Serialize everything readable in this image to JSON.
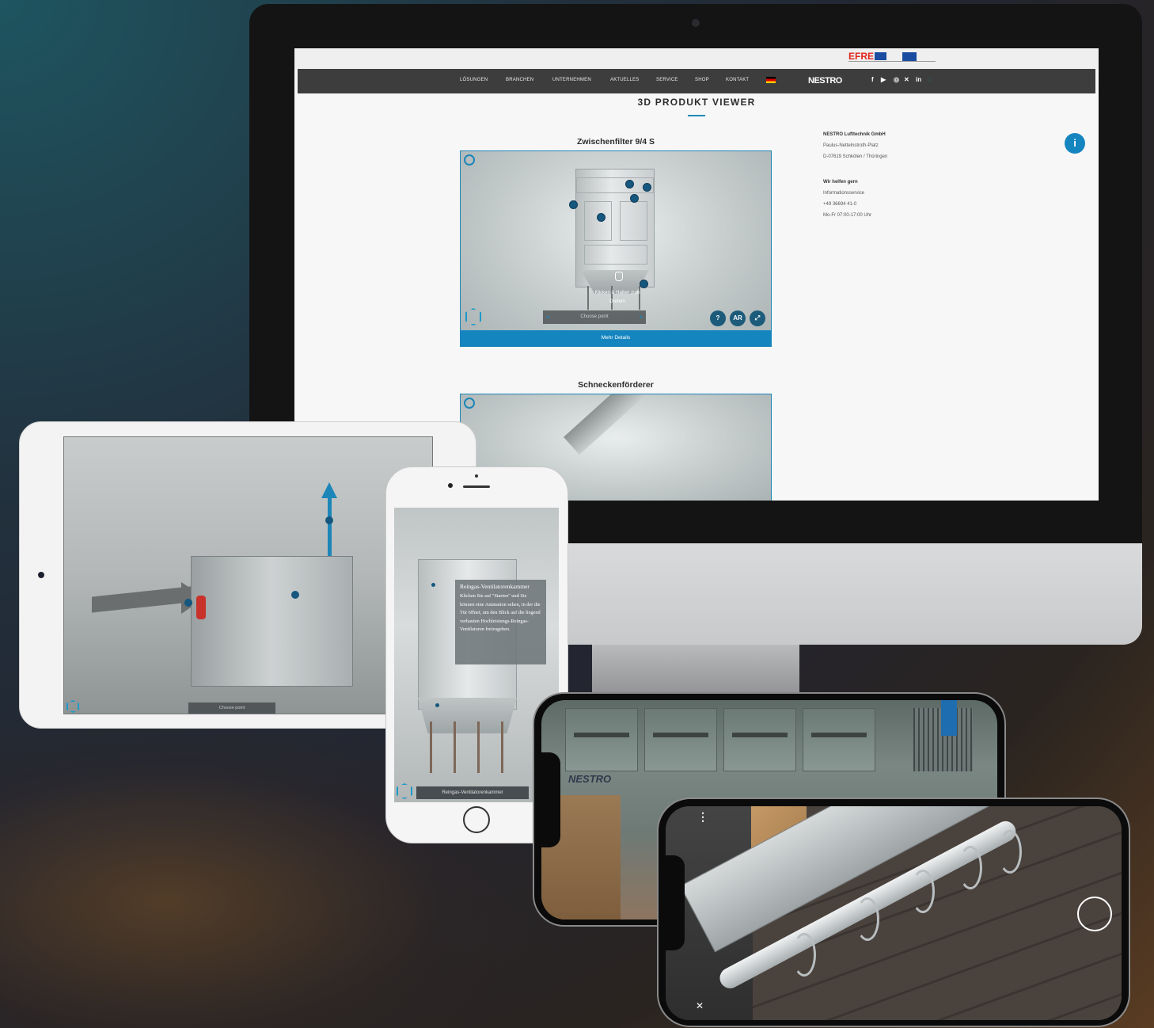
{
  "efre": {
    "logo": "EFRE"
  },
  "nav": {
    "items": [
      "LÖSUNGEN",
      "BRANCHEN",
      "UNTERNEHMEN",
      "AKTUELLES",
      "SERVICE",
      "SHOP",
      "KONTAKT"
    ],
    "brand": "NESTRO",
    "social": [
      "f",
      "▶",
      "◎",
      "✕",
      "in",
      "◌"
    ]
  },
  "page": {
    "title": "3D PRODUKT VIEWER"
  },
  "products": [
    {
      "title": "Zwischenfilter 9/4 S",
      "hint": "Klicken & Halten zum Drehen",
      "choose_point": "Choose point",
      "buttons": [
        "?",
        "AR",
        "⤢"
      ],
      "details": "Mehr Details"
    },
    {
      "title": "Schneckenförderer"
    }
  ],
  "contact": {
    "company": "NESTRO Lufttechnik GmbH",
    "street": "Paulus-Nettelnstroth-Platz",
    "city": "D-07619 Schkölen / Thüringen",
    "help_heading": "Wir helfen gern",
    "service": "Informationsservice",
    "phone": "+49 36694 41-0",
    "hours": "Mo-Fr 07:00-17:00 Uhr"
  },
  "info_button": "i",
  "ipad": {
    "choose_point": "Choose point"
  },
  "iphone": {
    "tooltip_title": "Reingas-Ventilatorenkammer",
    "tooltip_body": "Klicken Sie auf \"Starten\" und Sie können eine Animation sehen, in der die Tür öffnet, um den Blick auf die liegend verbauten Hochleistungs-Reingas-Ventilatoren freizugeben.",
    "bar_label": "Reingas-Ventilatorenkammer"
  },
  "phonex1": {
    "logo": "NESTRO"
  },
  "phonex2": {
    "menu": "⋮",
    "close": "✕"
  },
  "colors": {
    "accent": "#1585c0",
    "nav": "#3d3d3d",
    "hotspot": "#15577e"
  }
}
